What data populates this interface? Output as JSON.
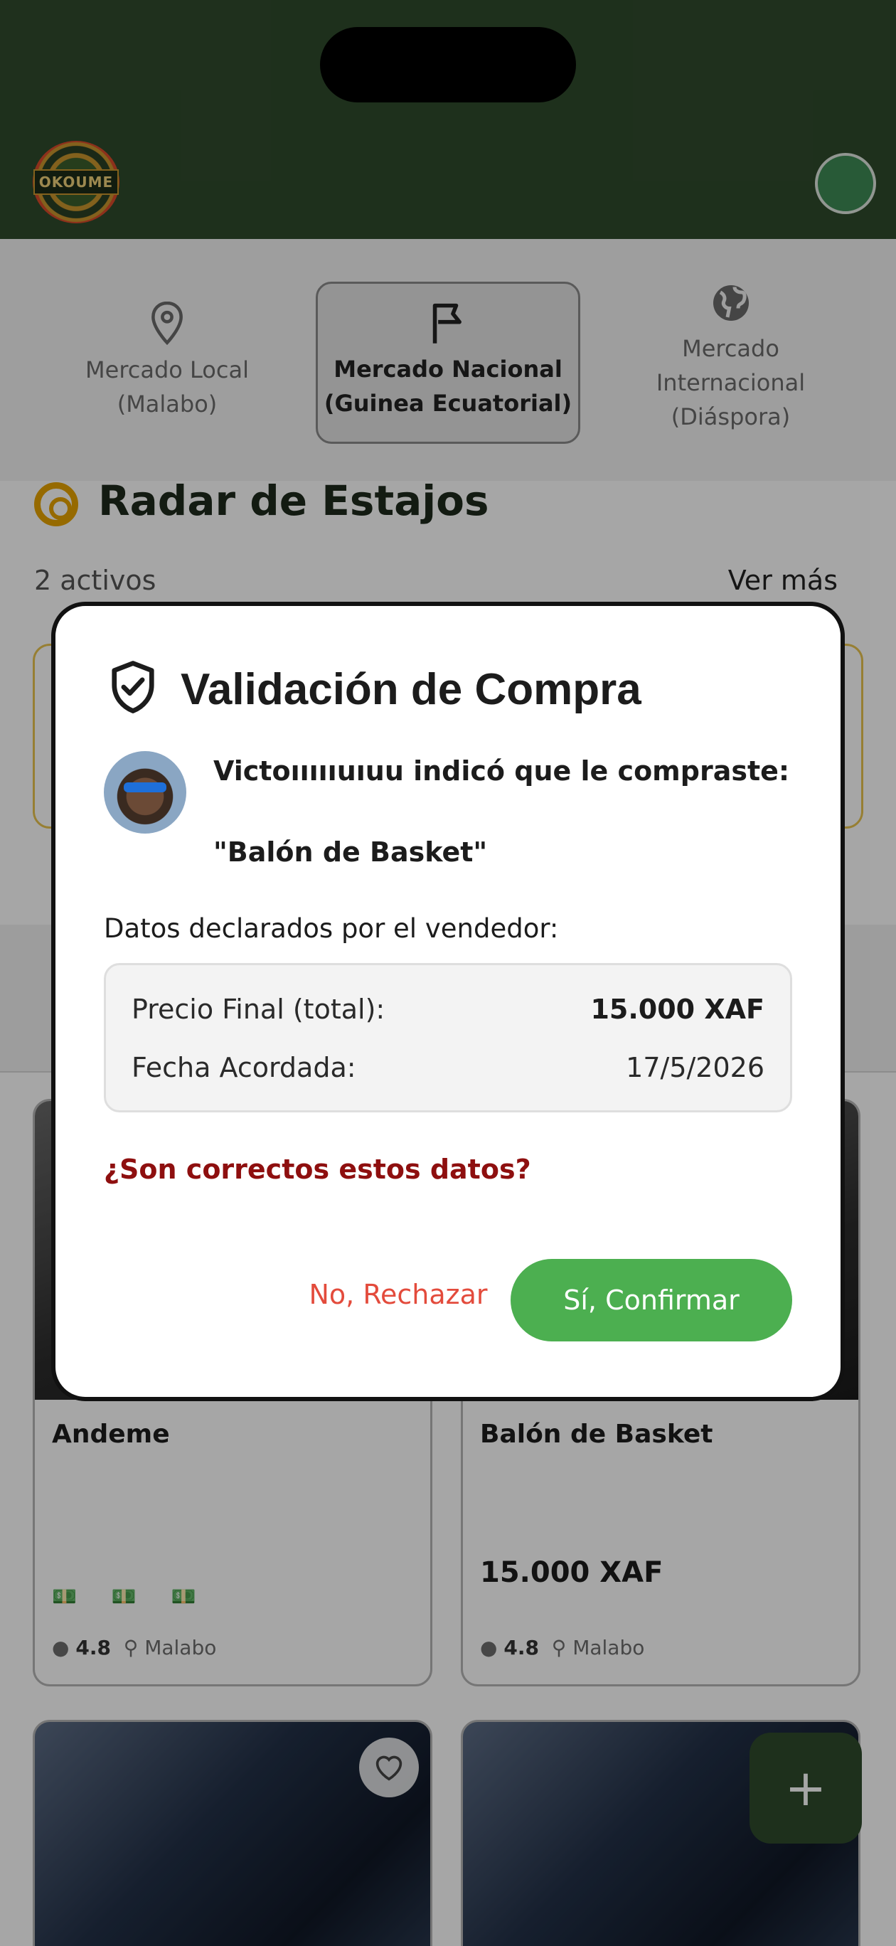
{
  "app": {
    "logo_text": "OKOUME"
  },
  "markets": [
    {
      "label_line1": "Mercado Local",
      "label_line2": "(Malabo)",
      "icon": "location-pin-icon",
      "selected": false
    },
    {
      "label_line1": "Mercado Nacional",
      "label_line2": "(Guinea Ecuatorial)",
      "icon": "flag-icon",
      "selected": true
    },
    {
      "label_line1": "Mercado",
      "label_line2": "Internacional",
      "label_line3": "(Diáspora)",
      "icon": "globe-icon",
      "selected": false
    }
  ],
  "radar": {
    "title": "Radar de Estajos",
    "count": "2 activos",
    "see_more": "Ver más"
  },
  "listings": [
    {
      "name": "Andeme",
      "price_level": "💵 💵 💵",
      "rating": "4.8",
      "location": "Malabo"
    },
    {
      "name": "Balón de Basket",
      "price": "15.000 XAF",
      "rating": "4.8",
      "location": "Malabo"
    }
  ],
  "fab": {
    "label": "+"
  },
  "dialog": {
    "title": "Validación de Compra",
    "message": "Victoıııııuıuu indicó que le compraste:",
    "product": "\"Balón de Basket\"",
    "declared_heading": "Datos declarados por el vendedor:",
    "price_label": "Precio Final (total):",
    "price_value": "15.000 XAF",
    "date_label": "Fecha Acordada:",
    "date_value": "17/5/2026",
    "question": "¿Son correctos estos datos?",
    "reject_label": "No, Rechazar",
    "confirm_label": "Sí, Confirmar"
  },
  "colors": {
    "header": "#2f4a2c",
    "confirm": "#4caf50",
    "reject": "#e34b3c",
    "question": "#8e0f0f",
    "radar_accent": "#e7a400"
  }
}
